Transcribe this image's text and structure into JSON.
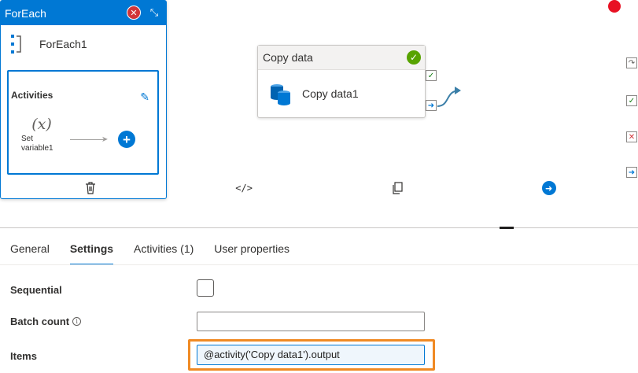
{
  "canvas": {
    "copy_activity": {
      "type_label": "Copy data",
      "name": "Copy data1",
      "status_icon": "check-circle-icon",
      "activity_icon": "database-icon"
    },
    "foreach_activity": {
      "type_label": "ForEach",
      "name": "ForEach1",
      "error_icon": "error-circle-icon",
      "collapse_icon": "collapse-icon",
      "activities_title": "Activities",
      "inner_activity": {
        "symbol": "(x)",
        "label_line1": "Set",
        "label_line2": "variable1"
      },
      "toolbar": [
        "delete-icon",
        "code-icon",
        "copy-icon",
        "go-icon"
      ]
    },
    "colors": {
      "accent": "#0078d4",
      "success": "#57a300",
      "error": "#d13438",
      "highlight": "#f08a24",
      "alert_dot": "#e81123"
    }
  },
  "properties": {
    "tabs": [
      {
        "label": "General",
        "active": false
      },
      {
        "label": "Settings",
        "active": true
      },
      {
        "label": "Activities (1)",
        "active": false
      },
      {
        "label": "User properties",
        "active": false
      }
    ],
    "sequential": {
      "label": "Sequential",
      "checked": false
    },
    "batch_count": {
      "label": "Batch count",
      "value": ""
    },
    "items": {
      "label": "Items",
      "value": "@activity('Copy data1').output"
    }
  }
}
